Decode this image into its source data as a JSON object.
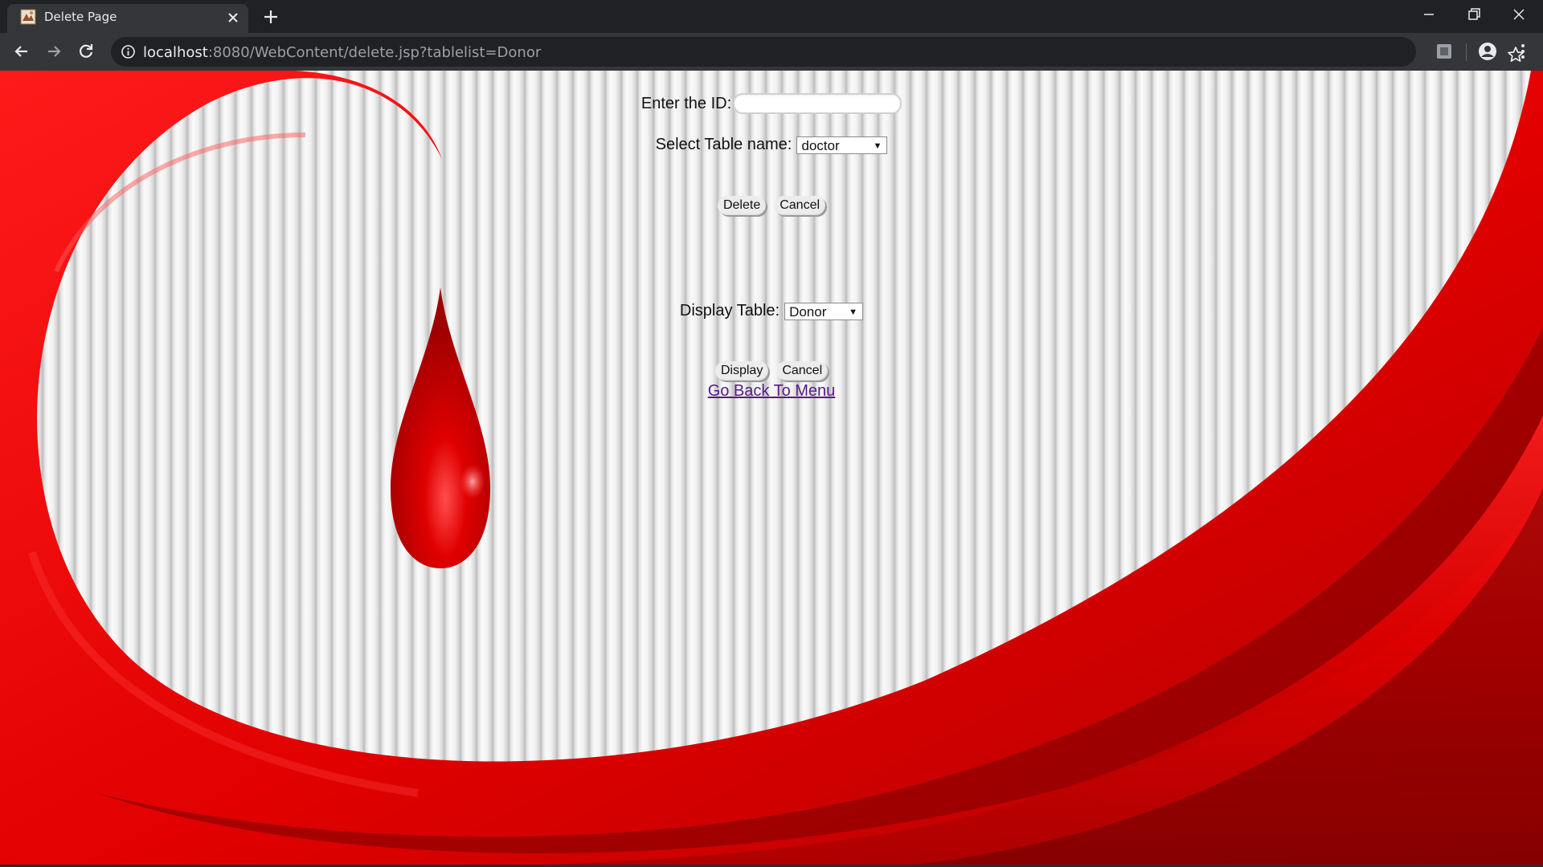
{
  "browser": {
    "tab_title": "Delete Page",
    "url_host": "localhost",
    "url_rest": ":8080/WebContent/delete.jsp?tablelist=Donor",
    "icons": {
      "back": "back-arrow-icon",
      "forward": "forward-arrow-icon",
      "reload": "reload-icon",
      "info": "info-icon",
      "bookmark": "star-icon",
      "extension": "extension-icon",
      "profile": "profile-icon",
      "menu": "kebab-menu-icon"
    }
  },
  "delete_form": {
    "id_label": "Enter the ID:",
    "id_value": "",
    "table_label": "Select Table name:",
    "table_selected": "doctor",
    "delete_button": "Delete",
    "cancel_button": "Cancel"
  },
  "display_form": {
    "table_label": "Display Table:",
    "table_selected": "Donor",
    "display_button": "Display",
    "cancel_button": "Cancel"
  },
  "menu_link": "Go Back To Menu",
  "colors": {
    "accent_red": "#e00000",
    "dark_red": "#7a0000",
    "link": "#551a8b"
  }
}
